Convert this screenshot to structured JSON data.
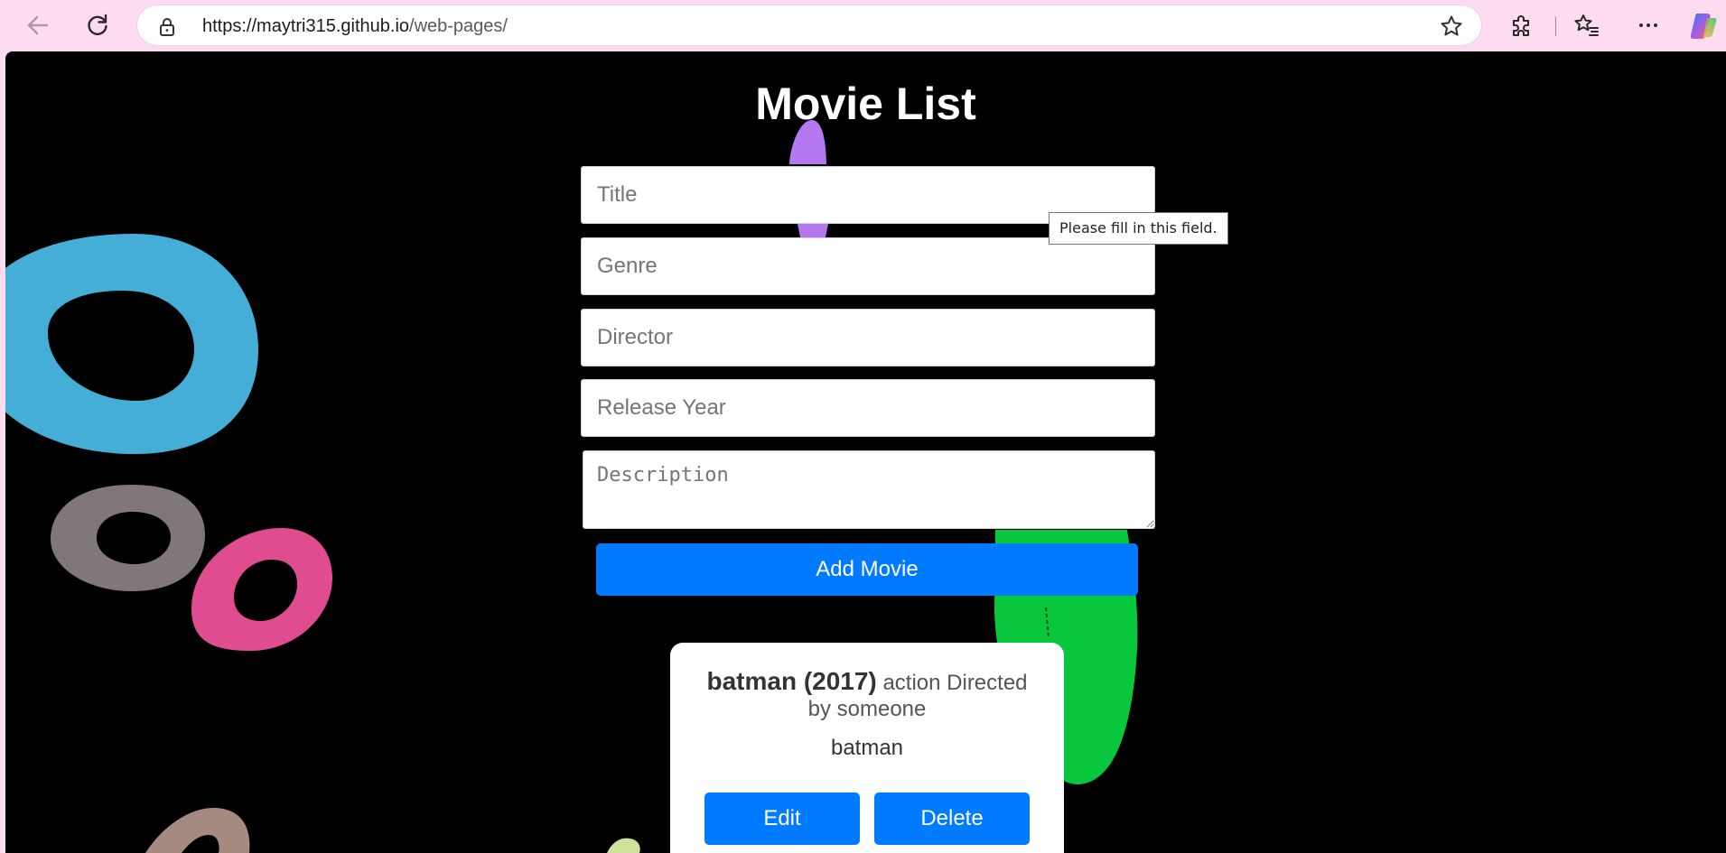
{
  "browser": {
    "url_host": "https://maytri315.github.io",
    "url_path": "/web-pages/",
    "back_icon": "arrow-left-icon",
    "reload_icon": "reload-icon",
    "lock_icon": "lock-icon",
    "favorite_icon": "star-icon",
    "extensions_icon": "puzzle-icon",
    "favorites_icon": "star-list-icon",
    "menu_icon": "more-icon",
    "copilot_icon": "copilot-icon"
  },
  "page": {
    "title": "Movie List",
    "form": {
      "title_placeholder": "Title",
      "genre_placeholder": "Genre",
      "director_placeholder": "Director",
      "year_placeholder": "Release Year",
      "description_placeholder": "Description",
      "submit_label": "Add Movie"
    },
    "validation_tooltip": "Please fill in this field.",
    "movies": [
      {
        "title_year": "batman (2017)",
        "meta": "action Directed by someone",
        "description": "batman",
        "edit_label": "Edit",
        "delete_label": "Delete"
      }
    ],
    "colors": {
      "background": "#000000",
      "button": "#007bff",
      "chrome": "#fddcf0"
    }
  }
}
